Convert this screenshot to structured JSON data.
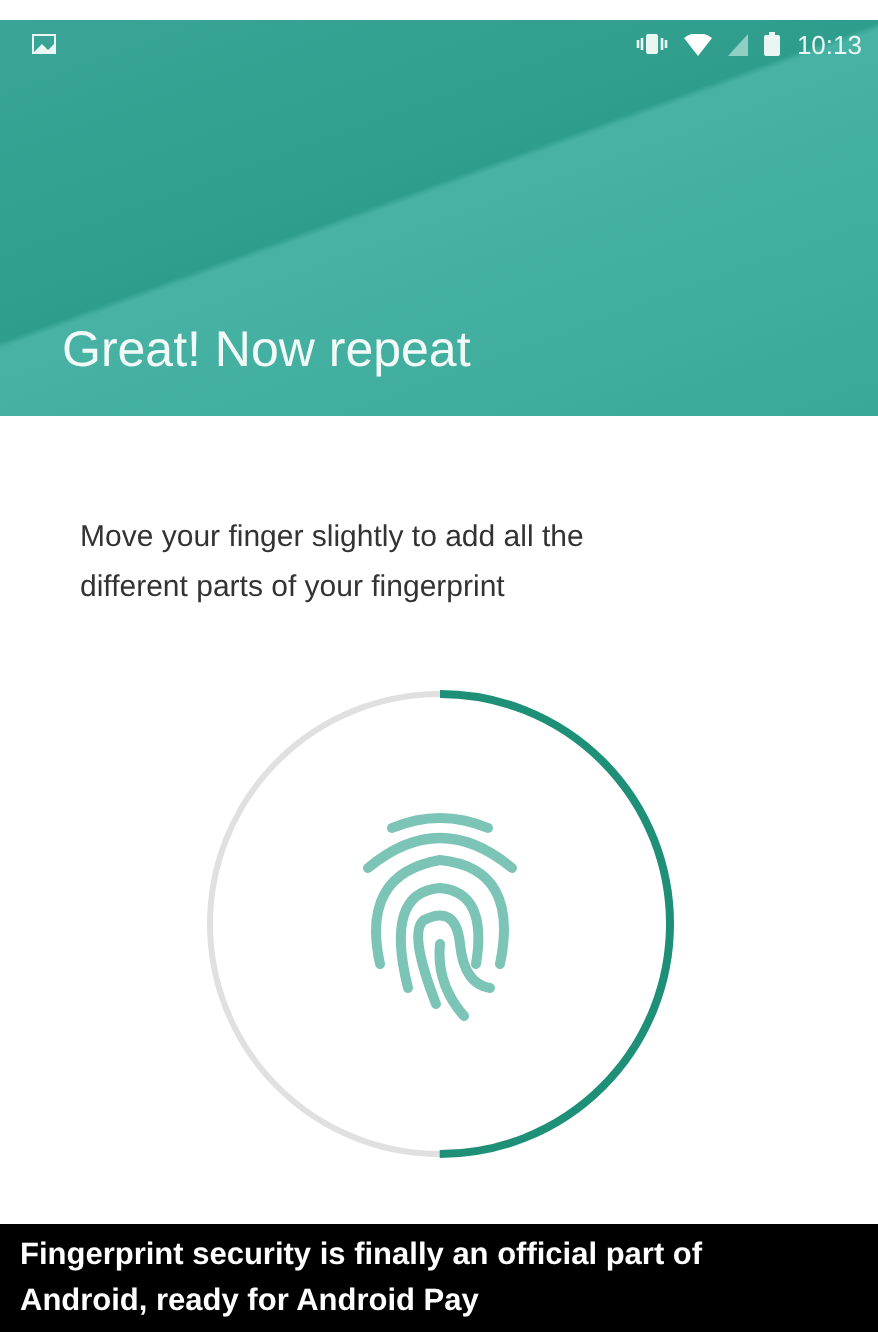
{
  "status_bar": {
    "time": "10:13"
  },
  "header": {
    "title": "Great! Now repeat"
  },
  "instruction": "Move your finger slightly to add all the different parts of your fingerprint",
  "caption": "Fingerprint security is finally an official part of Android, ready for Android Pay"
}
